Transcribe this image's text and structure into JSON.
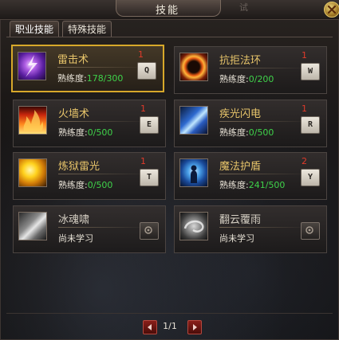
{
  "window": {
    "title": "技能",
    "title_extra": "试",
    "close_icon": "close-icon"
  },
  "tabs": [
    {
      "label": "职业技能",
      "active": true
    },
    {
      "label": "特殊技能",
      "active": false
    }
  ],
  "skills": [
    {
      "name": "雷击术",
      "level": "1",
      "prof_label": "熟练度:",
      "prof_current": "178",
      "prof_max": "300",
      "key": "Q",
      "learned": true,
      "selected": true,
      "icon": "lightning-icon"
    },
    {
      "name": "抗拒法环",
      "level": "1",
      "prof_label": "熟练度:",
      "prof_current": "0",
      "prof_max": "200",
      "key": "W",
      "learned": true,
      "selected": false,
      "icon": "fire-ring-icon"
    },
    {
      "name": "火墙术",
      "level": "1",
      "prof_label": "熟练度:",
      "prof_current": "0",
      "prof_max": "500",
      "key": "E",
      "learned": true,
      "selected": false,
      "icon": "firewall-icon"
    },
    {
      "name": "疾光闪电",
      "level": "1",
      "prof_label": "熟练度:",
      "prof_current": "0",
      "prof_max": "500",
      "key": "R",
      "learned": true,
      "selected": false,
      "icon": "light-bolt-icon"
    },
    {
      "name": "炼狱雷光",
      "level": "1",
      "prof_label": "熟练度:",
      "prof_current": "0",
      "prof_max": "500",
      "key": "T",
      "learned": true,
      "selected": false,
      "icon": "inferno-thunder-icon"
    },
    {
      "name": "魔法护盾",
      "level": "2",
      "prof_label": "熟练度:",
      "prof_current": "241",
      "prof_max": "500",
      "key": "Y",
      "learned": true,
      "selected": false,
      "icon": "magic-shield-icon"
    },
    {
      "name": "冰魂啸",
      "level": "",
      "status": "尚未学习",
      "learned": false,
      "selected": false,
      "icon": "ice-soul-icon"
    },
    {
      "name": "翻云覆雨",
      "level": "",
      "status": "尚未学习",
      "learned": false,
      "selected": false,
      "icon": "cloud-storm-icon"
    }
  ],
  "pager": {
    "text": "1/1",
    "prev_icon": "prev-arrow-icon",
    "next_icon": "next-arrow-icon"
  },
  "colors": {
    "skill_name": "#e7c46a",
    "level": "#e03a2a",
    "proficiency": "#3fd24a",
    "selected_border": "#d7a82a"
  }
}
